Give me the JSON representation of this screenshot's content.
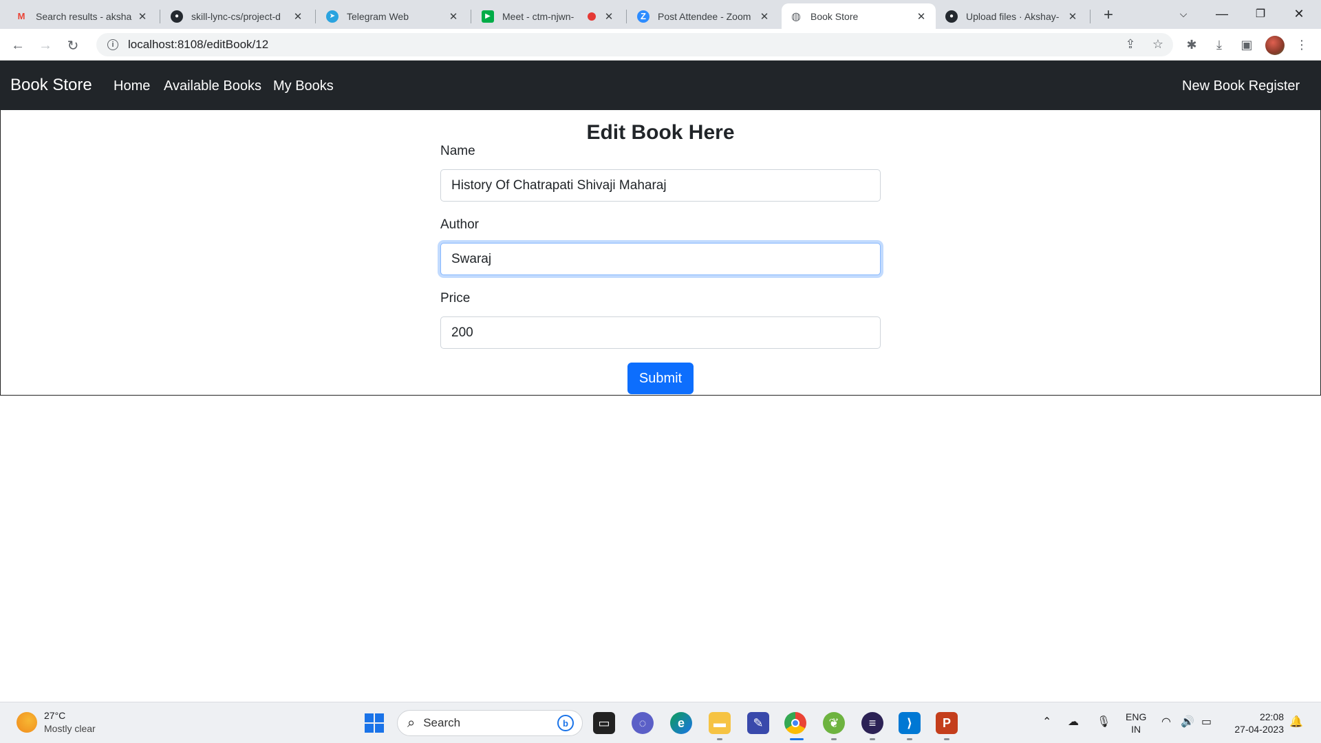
{
  "browser": {
    "tabs": [
      {
        "label": "Search results - aksha",
        "icon": "gmail-icon"
      },
      {
        "label": "skill-lync-cs/project-d",
        "icon": "github-icon"
      },
      {
        "label": "Telegram Web",
        "icon": "telegram-icon"
      },
      {
        "label": "Meet - ctm-njwn-",
        "icon": "meet-icon"
      },
      {
        "label": "Post Attendee - Zoom",
        "icon": "zoom-icon"
      },
      {
        "label": "Book Store",
        "icon": "globe-icon"
      },
      {
        "label": "Upload files · Akshay-",
        "icon": "github-icon"
      }
    ],
    "active_tab": 5,
    "url": "localhost:8108/editBook/12"
  },
  "navbar": {
    "brand": "Book Store",
    "links": [
      "Home",
      "Available Books",
      "My Books"
    ],
    "right_link": "New Book Register"
  },
  "form": {
    "title": "Edit Book Here",
    "fields": [
      {
        "label": "Name",
        "value": "History Of Chatrapati Shivaji Maharaj"
      },
      {
        "label": "Author",
        "value": "Swaraj"
      },
      {
        "label": "Price",
        "value": "200"
      }
    ],
    "focused_field": "Author",
    "submit_label": "Submit"
  },
  "taskbar": {
    "weather_temp": "27°C",
    "weather_desc": "Mostly clear",
    "search_label": "Search",
    "lang_top": "ENG",
    "lang_bottom": "IN",
    "time": "22:08",
    "date": "27-04-2023"
  }
}
